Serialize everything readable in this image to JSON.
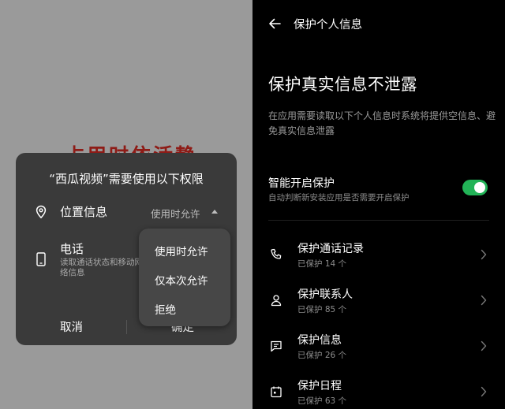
{
  "left": {
    "background_text": "占用时依活静",
    "dialog": {
      "title": "“西瓜视频”需要使用以下权限",
      "permissions": [
        {
          "label": "位置信息",
          "value": "使用时允许",
          "icon": "location-pin-icon"
        },
        {
          "label": "电话",
          "description": "读取通话状态和移动网络信息",
          "icon": "phone-device-icon"
        }
      ],
      "cancel_label": "取消",
      "confirm_label": "确定"
    },
    "dropdown": {
      "options": [
        "使用时允许",
        "仅本次允许",
        "拒绝"
      ]
    }
  },
  "right": {
    "header_title": "保护个人信息",
    "main_title": "保护真实信息不泄露",
    "description": "在应用需要读取以下个人信息时系统将提供空信息、避免真实信息泄露",
    "smart_protect": {
      "title": "智能开启保护",
      "subtitle": "自动判断新安装应用是否需要开启保护",
      "enabled": true,
      "color": "#22b357"
    },
    "items": [
      {
        "title": "保护通话记录",
        "subtitle": "已保护 14 个",
        "icon": "phone-icon"
      },
      {
        "title": "保护联系人",
        "subtitle": "已保护 85 个",
        "icon": "contact-person-icon"
      },
      {
        "title": "保护信息",
        "subtitle": "已保护 26 个",
        "icon": "message-icon"
      },
      {
        "title": "保护日程",
        "subtitle": "已保护 63 个",
        "icon": "calendar-icon"
      }
    ]
  }
}
